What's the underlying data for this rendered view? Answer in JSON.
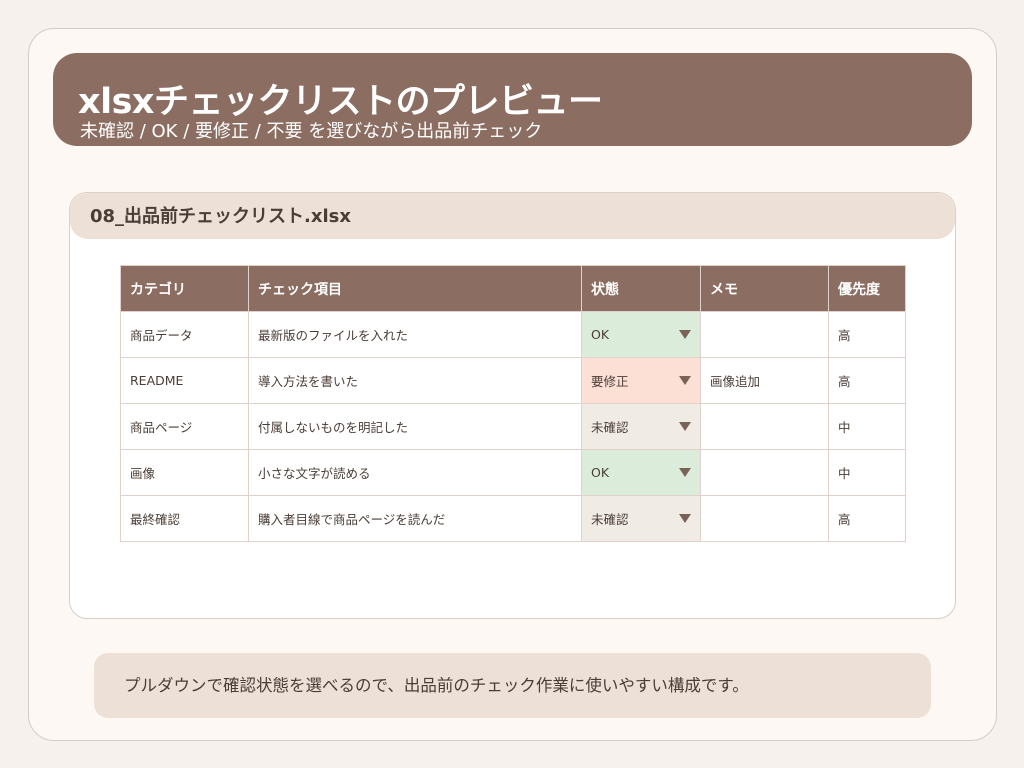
{
  "header": {
    "title": "xlsxチェックリストのプレビュー",
    "subtitle": "未確認 / OK / 要修正 / 不要 を選びながら出品前チェック"
  },
  "card": {
    "filename": "08_出品前チェックリスト.xlsx"
  },
  "sheet": {
    "columns": [
      "カテゴリ",
      "チェック項目",
      "状態",
      "メモ",
      "優先度"
    ],
    "rows": [
      {
        "category": "商品データ",
        "item": "最新版のファイルを入れた",
        "status": "OK",
        "memo": "",
        "priority": "高"
      },
      {
        "category": "README",
        "item": "導入方法を書いた",
        "status": "要修正",
        "memo": "画像追加",
        "priority": "高"
      },
      {
        "category": "商品ページ",
        "item": "付属しないものを明記した",
        "status": "未確認",
        "memo": "",
        "priority": "中"
      },
      {
        "category": "画像",
        "item": "小さな文字が読める",
        "status": "OK",
        "memo": "",
        "priority": "中"
      },
      {
        "category": "最終確認",
        "item": "購入者目線で商品ページを読んだ",
        "status": "未確認",
        "memo": "",
        "priority": "高"
      }
    ]
  },
  "status_colors": {
    "OK": "#dcecdb",
    "要修正": "#fde0d5",
    "未確認": "#f1ebe6"
  },
  "footer": {
    "text": "プルダウンで確認状態を選べるので、出品前のチェック作業に使いやすい構成です。"
  },
  "icons": {
    "dropdown": "caret-down-icon"
  }
}
